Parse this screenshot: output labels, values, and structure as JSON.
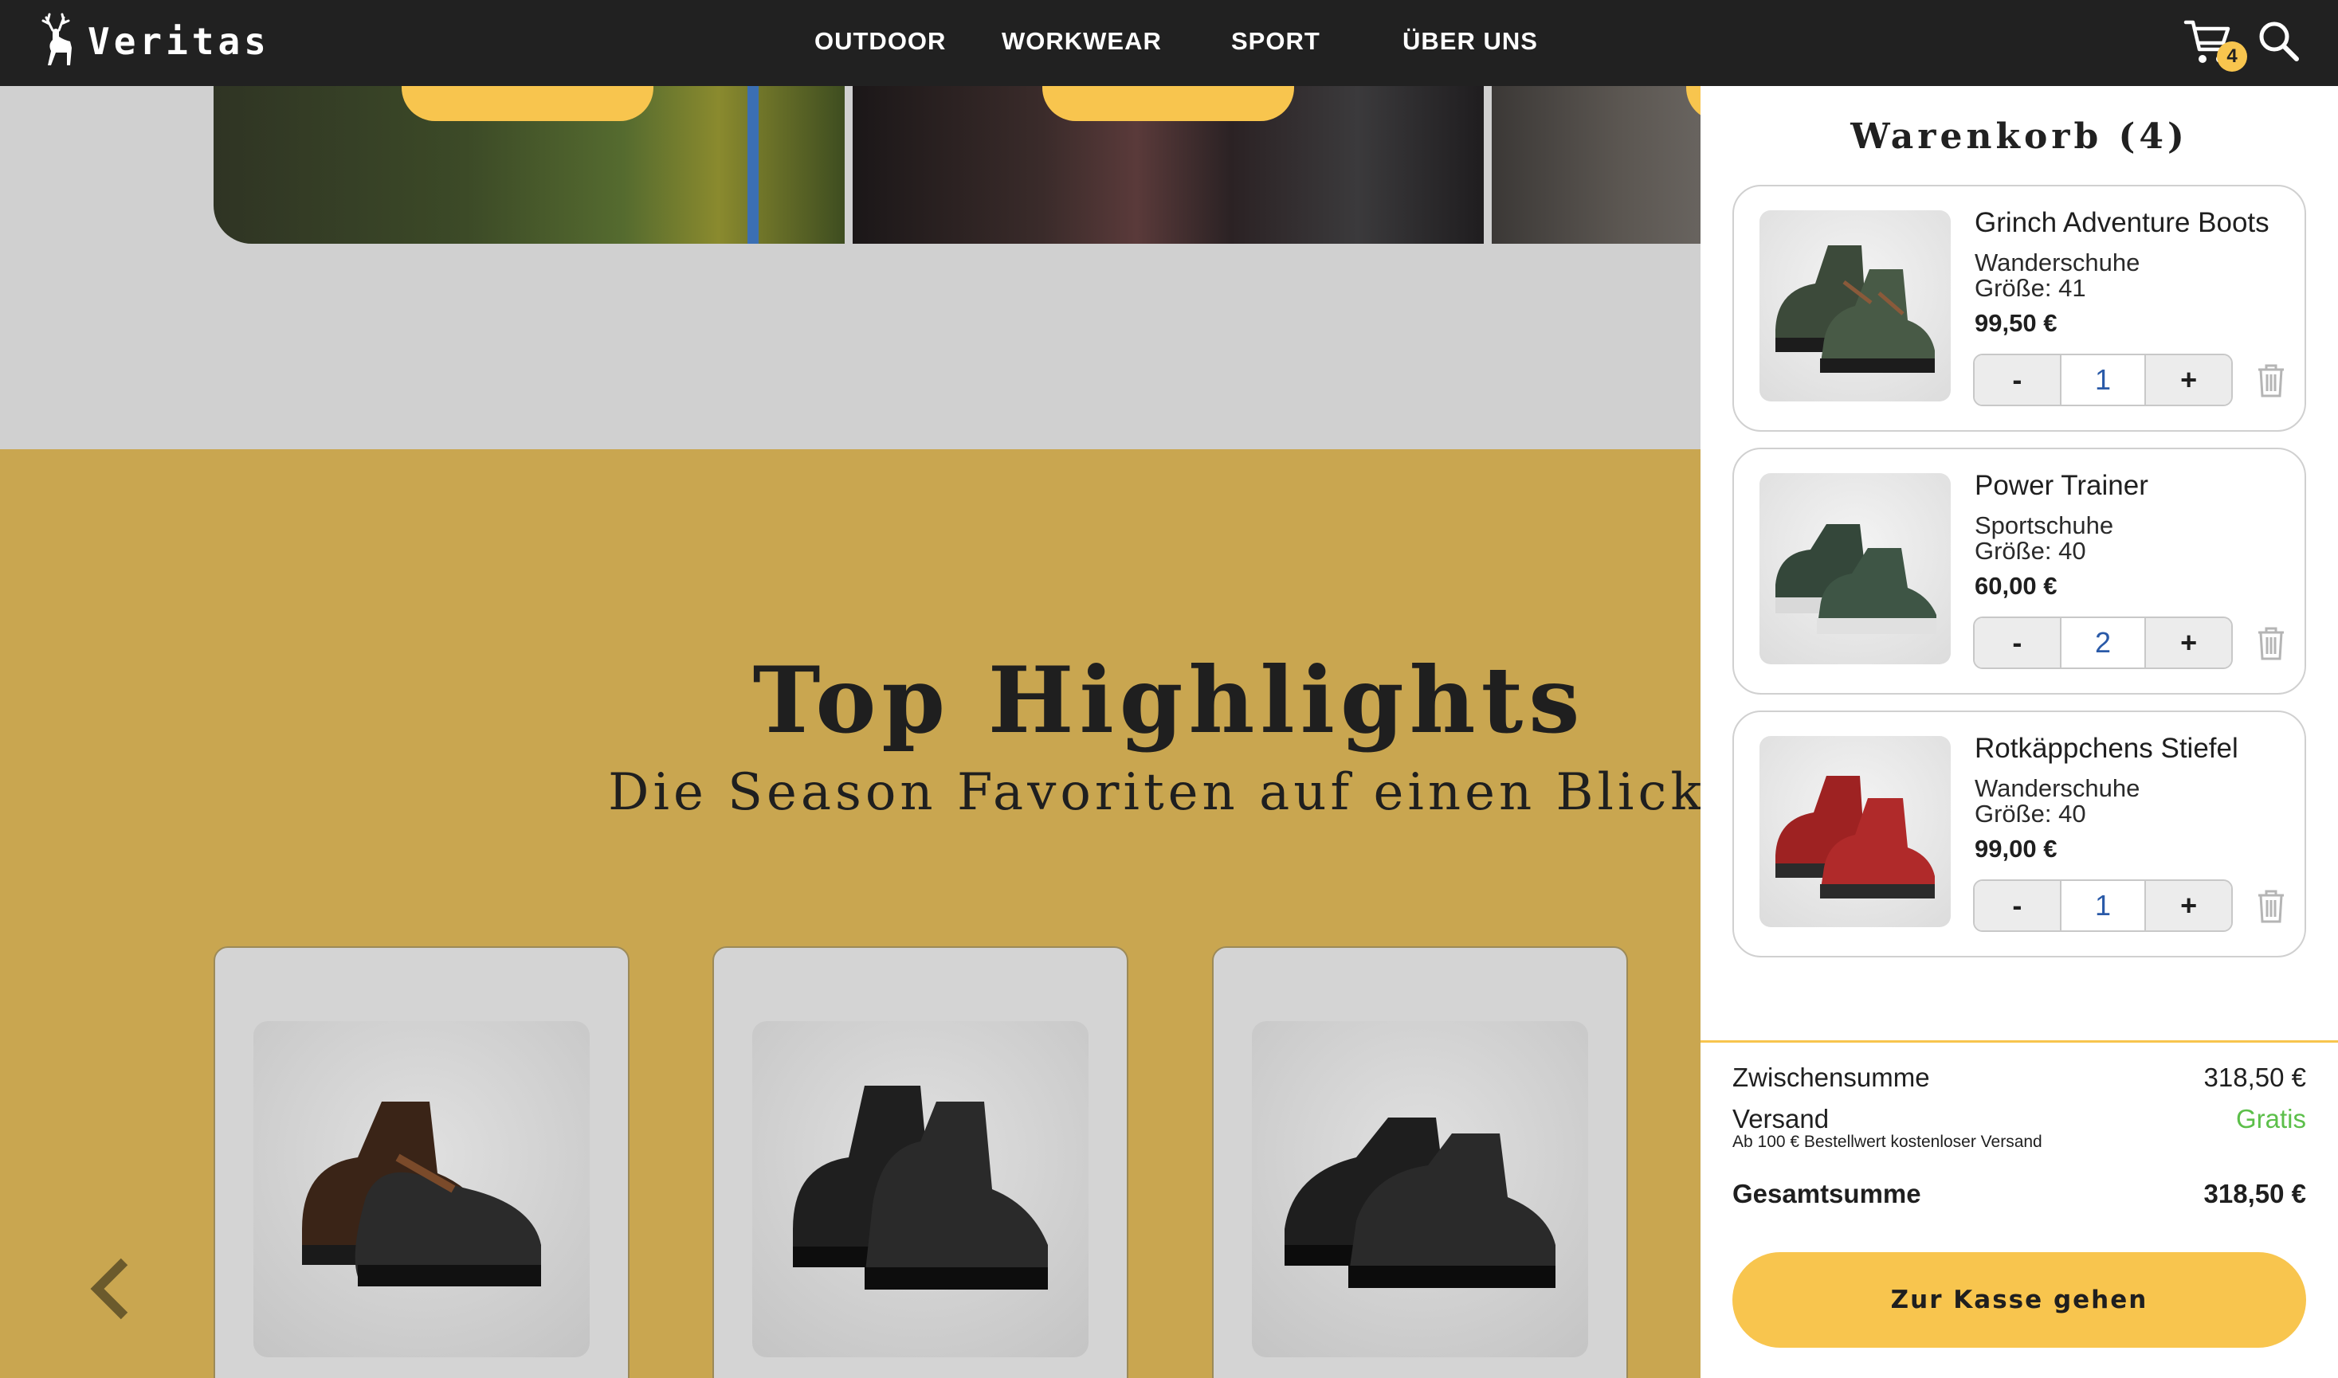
{
  "brand": {
    "name": "Veritas"
  },
  "nav": {
    "items": [
      {
        "label": "OUTDOOR"
      },
      {
        "label": "WORKWEAR"
      },
      {
        "label": "SPORT"
      },
      {
        "label": "ÜBER UNS"
      }
    ]
  },
  "header": {
    "cart_count": "4",
    "cart_icon": "shopping-cart-icon",
    "search_icon": "search-icon"
  },
  "highlights": {
    "title": "Top Highlights",
    "subtitle": "Die Season Favoriten auf einen Blick!",
    "products": [
      {
        "image": "brown-black-work-boots"
      },
      {
        "image": "black-lace-up-boots"
      },
      {
        "image": "black-safety-shoes"
      }
    ]
  },
  "cart": {
    "title": "Warenkorb (4)",
    "items": [
      {
        "name": "Grinch Adventure Boots",
        "category": "Wanderschuhe",
        "size": "Größe: 41",
        "price": "99,50 €",
        "quantity": "1",
        "minus": "-",
        "plus": "+"
      },
      {
        "name": "Power Trainer",
        "category": "Sportschuhe",
        "size": "Größe: 40",
        "price": "60,00 €",
        "quantity": "2",
        "minus": "-",
        "plus": "+"
      },
      {
        "name": "Rotkäppchens Stiefel",
        "category": "Wanderschuhe",
        "size": "Größe: 40",
        "price": "99,00 €",
        "quantity": "1",
        "minus": "-",
        "plus": "+"
      }
    ],
    "subtotal_label": "Zwischensumme",
    "subtotal_value": "318,50 €",
    "shipping_label": "Versand",
    "shipping_value": "Gratis",
    "shipping_note": "Ab 100 € Bestellwert kostenloser Versand",
    "total_label": "Gesamtsumme",
    "total_value": "318,50 €",
    "checkout_label": "Zur Kasse gehen"
  },
  "colors": {
    "topbar": "#212121",
    "accent": "#f8c54e",
    "highlight_bg": "#c9a650",
    "page_bg": "#d0d0d0",
    "shipping_free": "#5cbf4a"
  }
}
